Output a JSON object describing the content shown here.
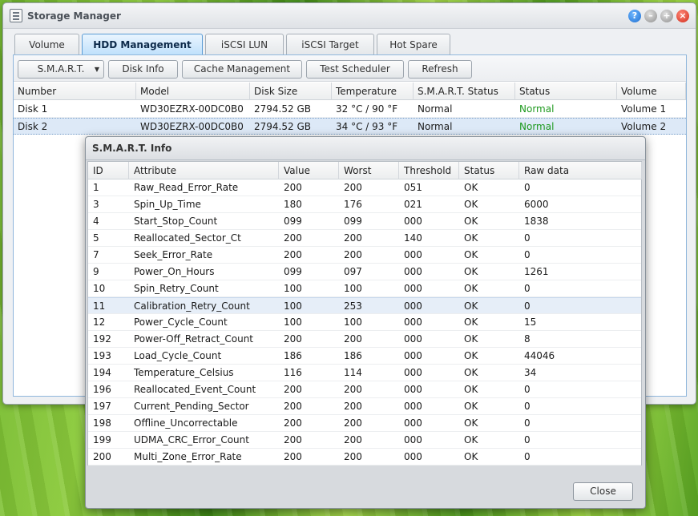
{
  "window": {
    "title": "Storage Manager",
    "controls": {
      "help": "?",
      "minimize": "–",
      "maximize": "+",
      "close": "×"
    }
  },
  "tabs": [
    {
      "label": "Volume"
    },
    {
      "label": "HDD Management"
    },
    {
      "label": "iSCSI LUN"
    },
    {
      "label": "iSCSI Target"
    },
    {
      "label": "Hot Spare"
    }
  ],
  "toolbar": {
    "smart": "S.M.A.R.T.",
    "disk_info": "Disk Info",
    "cache": "Cache Management",
    "scheduler": "Test Scheduler",
    "refresh": "Refresh",
    "caret": "▼"
  },
  "disks": {
    "columns": [
      "Number",
      "Model",
      "Disk Size",
      "Temperature",
      "S.M.A.R.T. Status",
      "Status",
      "Volume"
    ],
    "rows": [
      [
        "Disk 1",
        "WD30EZRX-00DC0B0",
        "2794.52 GB",
        "32 °C / 90 °F",
        "Normal",
        "Normal",
        "Volume 1"
      ],
      [
        "Disk 2",
        "WD30EZRX-00DC0B0",
        "2794.52 GB",
        "34 °C / 93 °F",
        "Normal",
        "Normal",
        "Volume 2"
      ]
    ]
  },
  "smart_dialog": {
    "title": "S.M.A.R.T. Info",
    "columns": [
      "ID",
      "Attribute",
      "Value",
      "Worst",
      "Threshold",
      "Status",
      "Raw data"
    ],
    "rows": [
      [
        "1",
        "Raw_Read_Error_Rate",
        "200",
        "200",
        "051",
        "OK",
        "0"
      ],
      [
        "3",
        "Spin_Up_Time",
        "180",
        "176",
        "021",
        "OK",
        "6000"
      ],
      [
        "4",
        "Start_Stop_Count",
        "099",
        "099",
        "000",
        "OK",
        "1838"
      ],
      [
        "5",
        "Reallocated_Sector_Ct",
        "200",
        "200",
        "140",
        "OK",
        "0"
      ],
      [
        "7",
        "Seek_Error_Rate",
        "200",
        "200",
        "000",
        "OK",
        "0"
      ],
      [
        "9",
        "Power_On_Hours",
        "099",
        "097",
        "000",
        "OK",
        "1261"
      ],
      [
        "10",
        "Spin_Retry_Count",
        "100",
        "100",
        "000",
        "OK",
        "0"
      ],
      [
        "11",
        "Calibration_Retry_Count",
        "100",
        "253",
        "000",
        "OK",
        "0"
      ],
      [
        "12",
        "Power_Cycle_Count",
        "100",
        "100",
        "000",
        "OK",
        "15"
      ],
      [
        "192",
        "Power-Off_Retract_Count",
        "200",
        "200",
        "000",
        "OK",
        "8"
      ],
      [
        "193",
        "Load_Cycle_Count",
        "186",
        "186",
        "000",
        "OK",
        "44046"
      ],
      [
        "194",
        "Temperature_Celsius",
        "116",
        "114",
        "000",
        "OK",
        "34"
      ],
      [
        "196",
        "Reallocated_Event_Count",
        "200",
        "200",
        "000",
        "OK",
        "0"
      ],
      [
        "197",
        "Current_Pending_Sector",
        "200",
        "200",
        "000",
        "OK",
        "0"
      ],
      [
        "198",
        "Offline_Uncorrectable",
        "200",
        "200",
        "000",
        "OK",
        "0"
      ],
      [
        "199",
        "UDMA_CRC_Error_Count",
        "200",
        "200",
        "000",
        "OK",
        "0"
      ],
      [
        "200",
        "Multi_Zone_Error_Rate",
        "200",
        "200",
        "000",
        "OK",
        "0"
      ]
    ],
    "close": "Close"
  },
  "colors": {
    "status_normal": "#1f9a1f",
    "selection": "#dde9f7",
    "active_tab": "#bfe0fb"
  }
}
